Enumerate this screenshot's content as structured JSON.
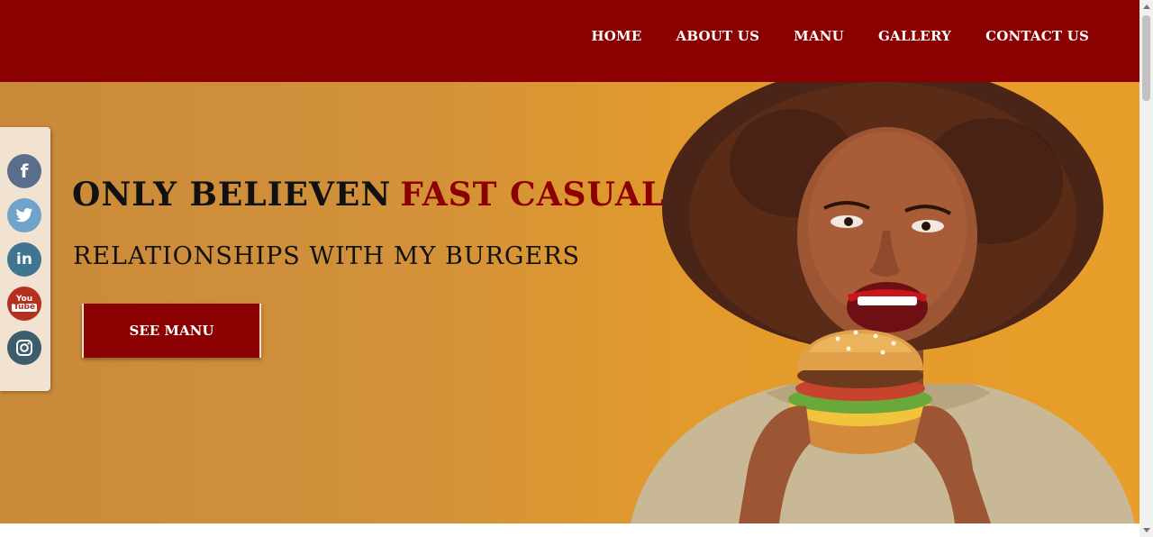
{
  "nav": {
    "items": [
      {
        "label": "HOME"
      },
      {
        "label": "ABOUT US"
      },
      {
        "label": "MANU"
      },
      {
        "label": "GALLERY"
      },
      {
        "label": "CONTACT US"
      }
    ]
  },
  "hero": {
    "title_main": "ONLY BELIEVEN",
    "title_accent": "FAST CASUAL",
    "subtitle": "RELATIONSHIPS WITH MY BURGERS",
    "cta_label": "SEE MANU",
    "image_alt": "woman-eating-burger"
  },
  "social": {
    "facebook": "f",
    "twitter": "twitter-icon",
    "linkedin": "in",
    "youtube_top": "You",
    "youtube_bottom": "Tube",
    "instagram": "instagram-icon"
  },
  "colors": {
    "brand": "#8b0000",
    "hero_bg": "#e29a2c",
    "sidebar_bg": "#f2e2d2"
  }
}
